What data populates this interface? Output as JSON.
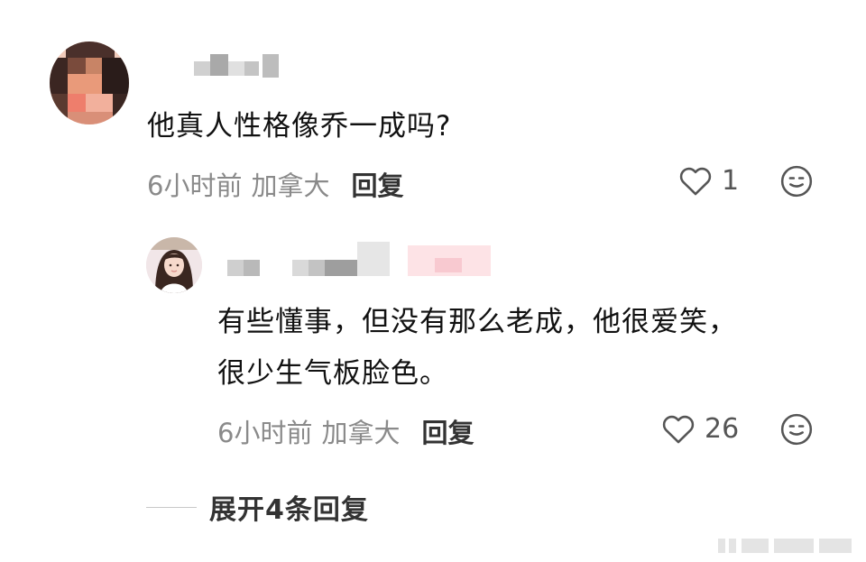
{
  "comments": [
    {
      "text": "他真人性格像乔一成吗?",
      "time": "6小时前",
      "location": "加拿大",
      "reply_label": "回复",
      "likes": "1"
    },
    {
      "text_line1": "有些懂事，但没有那么老成，他很爱笑，",
      "text_line2": "很少生气板脸色。",
      "time": "6小时前",
      "location": "加拿大",
      "reply_label": "回复",
      "likes": "26"
    }
  ],
  "expand_replies_label": "展开4条回复",
  "icons": {
    "like": "heart-outline-icon",
    "emoji": "emoji-icon"
  },
  "colors": {
    "text": "#111111",
    "meta": "#8a8a8a",
    "icon": "#555555"
  }
}
